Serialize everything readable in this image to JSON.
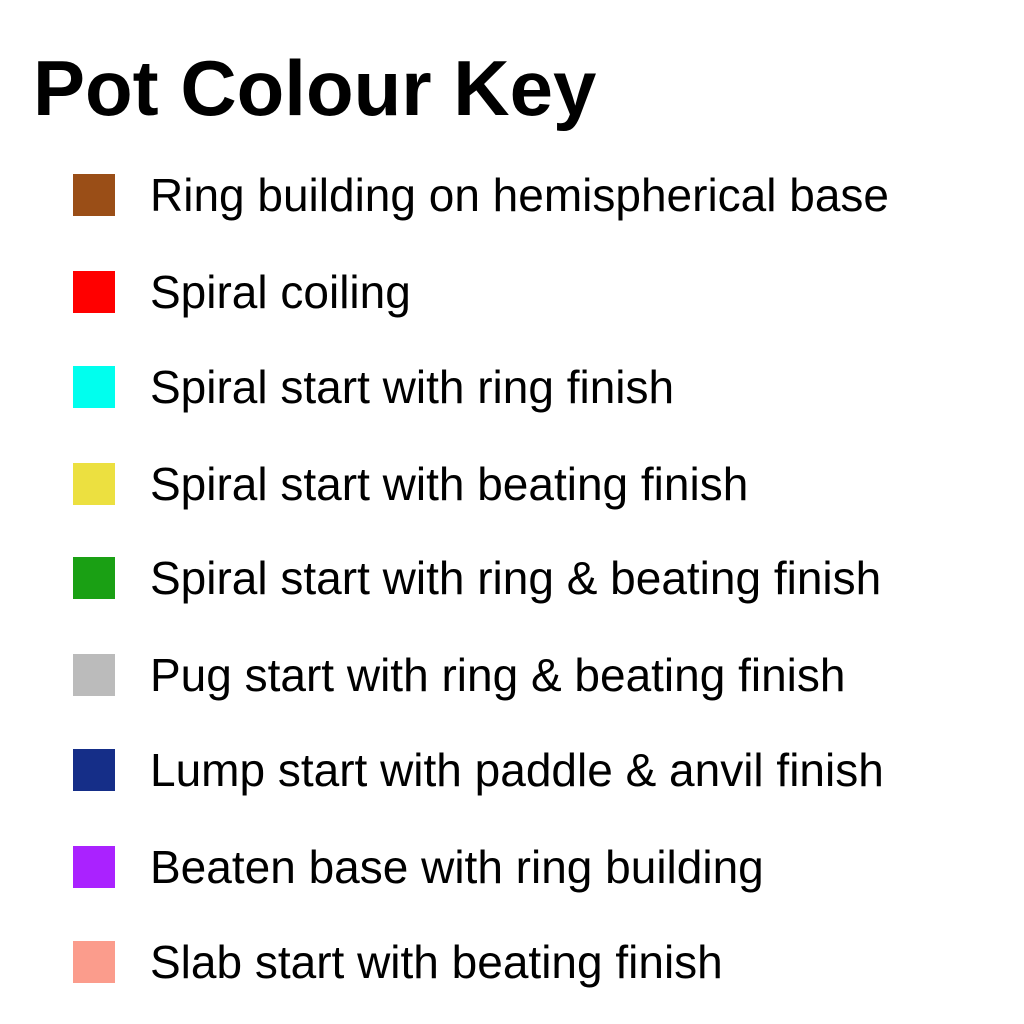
{
  "legend": {
    "title": "Pot Colour Key",
    "items": [
      {
        "label": "Ring building on hemispherical base",
        "color": "#9a4e17"
      },
      {
        "label": "Spiral coiling",
        "color": "#ff0000"
      },
      {
        "label": "Spiral start with ring finish",
        "color": "#00ffee"
      },
      {
        "label": "Spiral start with beating finish",
        "color": "#ece040"
      },
      {
        "label": "Spiral start with ring & beating finish",
        "color": "#1aa014"
      },
      {
        "label": "Pug start with ring & beating finish",
        "color": "#bbbbbb"
      },
      {
        "label": "Lump start with paddle & anvil finish",
        "color": "#152e88"
      },
      {
        "label": "Beaten base with ring building",
        "color": "#aa22ff"
      },
      {
        "label": "Slab start with beating finish",
        "color": "#fb9c8c"
      }
    ]
  }
}
